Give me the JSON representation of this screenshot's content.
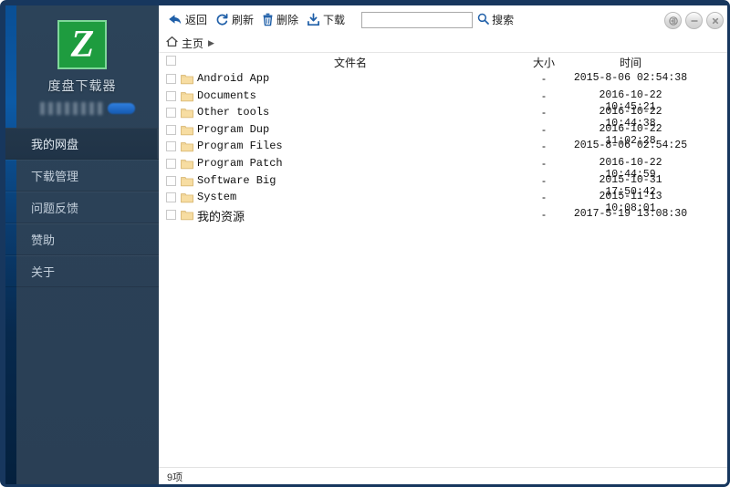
{
  "app": {
    "brand_title": "度盘下载器",
    "logo_letter": "Z"
  },
  "sidebar": {
    "items": [
      {
        "label": "我的网盘",
        "active": true
      },
      {
        "label": "下载管理",
        "active": false
      },
      {
        "label": "问题反馈",
        "active": false
      },
      {
        "label": "赞助",
        "active": false
      },
      {
        "label": "关于",
        "active": false
      }
    ]
  },
  "window_controls": [
    {
      "name": "logout-icon",
      "title": "退出登录"
    },
    {
      "name": "minimize-icon",
      "title": "最小化"
    },
    {
      "name": "close-icon",
      "title": "关闭"
    }
  ],
  "toolbar": {
    "back_label": "返回",
    "refresh_label": "刷新",
    "delete_label": "删除",
    "download_label": "下载",
    "search_value": "",
    "search_placeholder": "",
    "search_label": "搜索"
  },
  "breadcrumb": {
    "home_label": "主页",
    "separator": "▶"
  },
  "list": {
    "columns": {
      "name": "文件名",
      "size": "大小",
      "time": "时间"
    },
    "rows": [
      {
        "name": "Android App",
        "size": "-",
        "time": "2015-8-06 02:54:38",
        "cjk": false
      },
      {
        "name": "Documents",
        "size": "-",
        "time": "2016-10-22 10:45:21",
        "cjk": false
      },
      {
        "name": "Other tools",
        "size": "-",
        "time": "2016-10-22 10:44:38",
        "cjk": false
      },
      {
        "name": "Program Dup",
        "size": "-",
        "time": "2016-10-22 11:02:28",
        "cjk": false
      },
      {
        "name": "Program Files",
        "size": "-",
        "time": "2015-8-06 02:54:25",
        "cjk": false
      },
      {
        "name": "Program Patch",
        "size": "-",
        "time": "2016-10-22 10:44:59",
        "cjk": false
      },
      {
        "name": "Software Big",
        "size": "-",
        "time": "2015-10-31 17:50:42",
        "cjk": false
      },
      {
        "name": "System",
        "size": "-",
        "time": "2015-11-13 10:08:01",
        "cjk": false
      },
      {
        "name": "我的资源",
        "size": "-",
        "time": "2017-5-19 13:08:30",
        "cjk": true
      }
    ]
  },
  "statusbar": {
    "item_count": "9项"
  },
  "colors": {
    "window_border": "#17375e",
    "sidebar": "#2b4157",
    "sidebar_active": "#23374a",
    "logo_green": "#1e9c3f",
    "toolbar_icon_blue": "#1f5fa8",
    "folder": "#f5d79a",
    "edge_glow": "#0c5aa6"
  }
}
